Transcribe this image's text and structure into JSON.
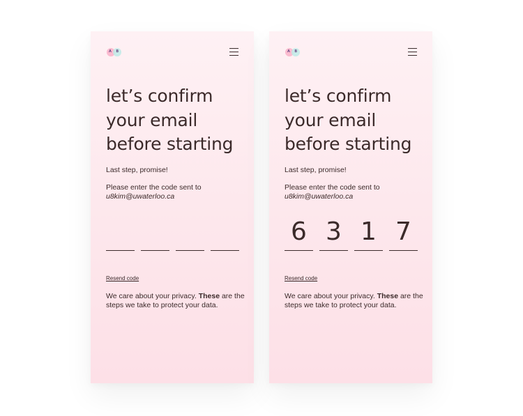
{
  "colors": {
    "page_background": "#ffffff",
    "card_gradient_top": "#fef1f4",
    "card_gradient_bottom": "#fde0e7",
    "text": "#3b2a2a",
    "logo_pink": "#faaac3",
    "logo_mint": "#beebe6"
  },
  "screens": [
    {
      "logo_text": "A B",
      "menu_icon": "hamburger-icon",
      "title_lines": [
        "let’s confirm",
        "your email",
        "before starting"
      ],
      "subtitle": "Last step, promise!",
      "instruction": "Please enter the code sent to",
      "email": "u8kim@uwaterloo.ca",
      "code_digits": [
        "",
        "",
        "",
        ""
      ],
      "resend_label": "Resend code",
      "privacy_prefix": "We care about your privacy.",
      "privacy_link": "These",
      "privacy_suffix": "are the steps we take to protect your data."
    },
    {
      "logo_text": "A B",
      "menu_icon": "hamburger-icon",
      "title_lines": [
        "let’s confirm",
        "your email",
        "before starting"
      ],
      "subtitle": "Last step, promise!",
      "instruction": "Please enter the code sent to",
      "email": "u8kim@uwaterloo.ca",
      "code_digits": [
        "6",
        "3",
        "1",
        "7"
      ],
      "resend_label": "Resend code",
      "privacy_prefix": "We care about your privacy.",
      "privacy_link": "These",
      "privacy_suffix": "are the steps we take to protect your data."
    }
  ]
}
